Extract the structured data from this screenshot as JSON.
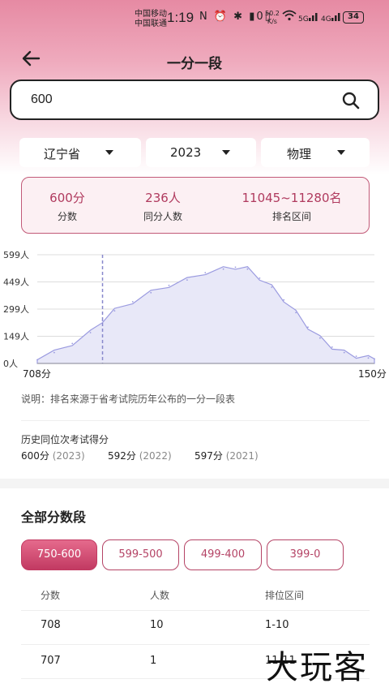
{
  "status": {
    "carrier1": "中国移动",
    "carrier2": "中国联通",
    "time": "1:19",
    "icons": "N ⏰ ✱ ▮0▯",
    "net_speed1": "50.2",
    "net_speed2": "K/s",
    "sig1": "5G",
    "sig2": "4G",
    "battery": "34"
  },
  "nav": {
    "back_icon": "←",
    "title": "一分一段"
  },
  "search": {
    "value": "600"
  },
  "filters": {
    "province": "辽宁省",
    "year": "2023",
    "subject": "物理"
  },
  "stats": [
    {
      "value": "600分",
      "label": "分数"
    },
    {
      "value": "236人",
      "label": "同分人数"
    },
    {
      "value": "11045~11280名",
      "label": "排名区间"
    }
  ],
  "chart_data": {
    "type": "area",
    "y_ticks": [
      "599人",
      "449人",
      "299人",
      "149人",
      "0人"
    ],
    "x_start_label": "708分",
    "x_end_label": "150分",
    "x_range": [
      708,
      150
    ],
    "ylim": [
      0,
      599
    ],
    "marker_score": 600,
    "series": [
      {
        "x": [
          708,
          680,
          650,
          620,
          600,
          580,
          550,
          520,
          490,
          460,
          430,
          400,
          380,
          360,
          340,
          320,
          300,
          280,
          260,
          240,
          220,
          200,
          180,
          160,
          150
        ],
        "values": [
          20,
          60,
          110,
          170,
          236,
          290,
          340,
          390,
          430,
          460,
          500,
          520,
          530,
          520,
          470,
          420,
          350,
          280,
          200,
          140,
          90,
          60,
          40,
          30,
          25
        ]
      }
    ],
    "fill_color": "#e8e8f8",
    "line_color": "#9b9be0"
  },
  "note": "说明：排名来源于省考试院历年公布的一分一段表",
  "history": {
    "title": "历史同位次考试得分",
    "items": [
      {
        "score": "600分",
        "year": "(2023)"
      },
      {
        "score": "592分",
        "year": "(2022)"
      },
      {
        "score": "597分",
        "year": "(2021)"
      }
    ]
  },
  "section_title": "全部分数段",
  "segments": [
    "750-600",
    "599-500",
    "499-400",
    "399-0"
  ],
  "table": {
    "headers": [
      "分数",
      "人数",
      "排位区间"
    ],
    "rows": [
      [
        "708",
        "10",
        "1-10"
      ],
      [
        "707",
        "1",
        "11-11"
      ]
    ]
  },
  "watermark": "大玩客",
  "colors": {
    "accent": "#b03a5e",
    "active_segment": "#c23a62"
  }
}
